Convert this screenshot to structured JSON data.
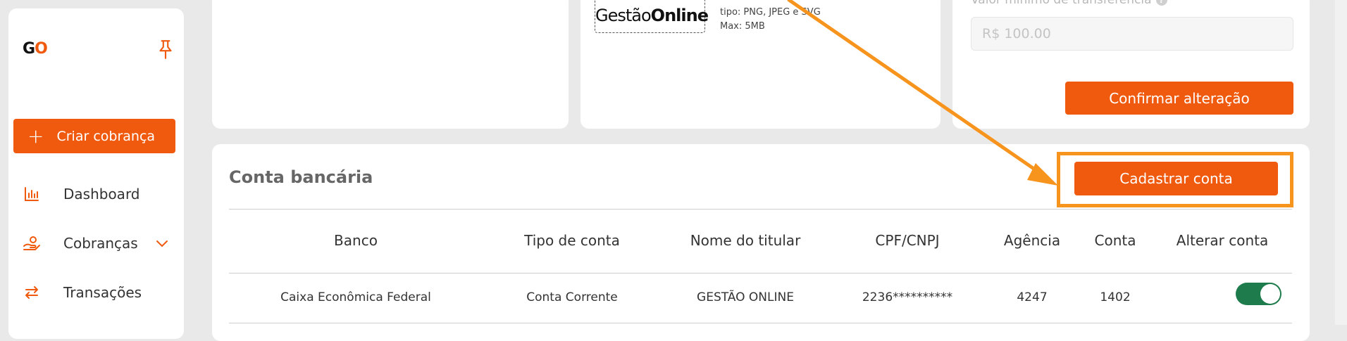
{
  "sidebar": {
    "logo_text_g": "G",
    "logo_text_o": "O",
    "create_label": "Criar cobrança",
    "items": [
      {
        "label": "Dashboard",
        "icon": "chart-icon"
      },
      {
        "label": "Cobranças",
        "icon": "hand-coins-icon"
      },
      {
        "label": "Transações",
        "icon": "arrows-swap-icon"
      }
    ]
  },
  "logo_upload": {
    "preview_regular": "Gestão",
    "preview_bold": "Online",
    "type_info": "tipo: PNG, JPEG e SVG",
    "max_info": "Max: 5MB"
  },
  "transfer": {
    "min_label": "Valor mínimo de transferência",
    "min_placeholder": "R$ 100.00",
    "confirm_label": "Confirmar alteração"
  },
  "bank": {
    "title": "Conta bancária",
    "register_label": "Cadastrar conta",
    "columns": [
      "Banco",
      "Tipo de conta",
      "Nome do titular",
      "CPF/CNPJ",
      "Agência",
      "Conta",
      "Alterar conta"
    ],
    "rows": [
      {
        "banco": "Caixa Econômica Federal",
        "tipo": "Conta Corrente",
        "titular": "GESTÃO ONLINE",
        "cpf": "2236**********",
        "agencia": "4247",
        "conta": "1402",
        "active": true
      }
    ]
  },
  "colors": {
    "accent": "#f05a0e",
    "highlight": "#f7941d",
    "toggle_on": "#1e7b4c"
  }
}
